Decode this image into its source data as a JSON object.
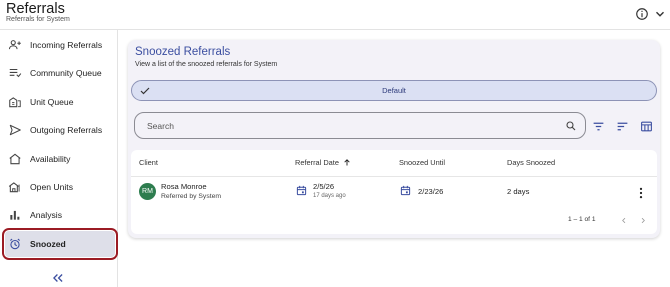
{
  "header": {
    "title": "Referrals",
    "subtitle": "Referrals for System",
    "info_icon": "info-icon",
    "menu_icon": "chevron-down-icon"
  },
  "sidebar": {
    "items": [
      {
        "label": "Incoming Referrals",
        "icon": "person-add-icon"
      },
      {
        "label": "Community Queue",
        "icon": "queue-list-icon"
      },
      {
        "label": "Unit Queue",
        "icon": "building-queue-icon"
      },
      {
        "label": "Outgoing Referrals",
        "icon": "send-icon"
      },
      {
        "label": "Availability",
        "icon": "home-icon"
      },
      {
        "label": "Open Units",
        "icon": "open-home-icon"
      },
      {
        "label": "Analysis",
        "icon": "bar-chart-icon"
      },
      {
        "label": "Snoozed",
        "icon": "alarm-icon",
        "active": true
      }
    ],
    "collapse_icon": "double-chevron-left-icon"
  },
  "main": {
    "title": "Snoozed Referrals",
    "subtitle": "View a list of the snoozed referrals for System",
    "view": {
      "label": "Default",
      "selected": true
    },
    "search": {
      "placeholder": "Search",
      "value": ""
    },
    "table": {
      "columns": [
        "Client",
        "Referral Date",
        "Snoozed Until",
        "Days Snoozed"
      ],
      "sort": {
        "column": "Referral Date",
        "direction": "ascending"
      },
      "rows": [
        {
          "initials": "RM",
          "name": "Rosa Monroe",
          "referred_by": "Referred by System",
          "referral_date": "2/5/26",
          "referral_ago": "17 days ago",
          "snoozed_until": "2/23/26",
          "days_snoozed": "2 days"
        }
      ],
      "pagination": "1 – 1 of 1"
    }
  },
  "colors": {
    "accent": "#3b4ea0",
    "active_outline": "#9b1b24",
    "avatar": "#2e7d4f",
    "chip_bg": "#dbe0f3"
  }
}
